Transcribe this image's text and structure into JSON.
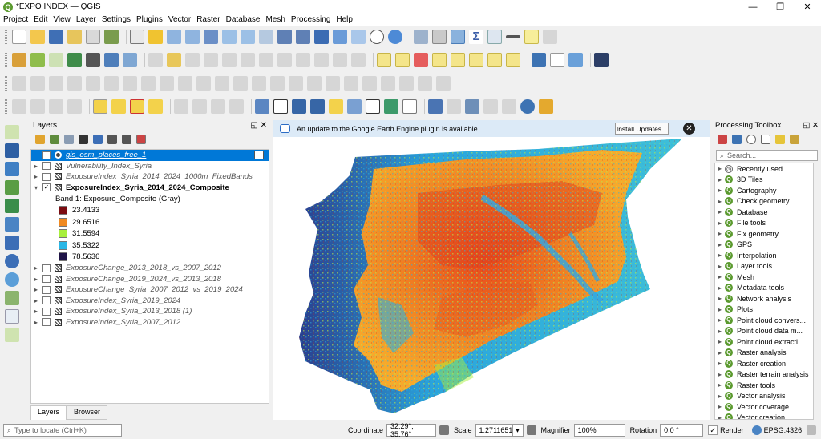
{
  "window": {
    "title": "*EXPO INDEX — QGIS",
    "logo_letter": "Q",
    "minimize": "—",
    "restore": "❐",
    "close": "✕"
  },
  "menu": [
    "Project",
    "Edit",
    "View",
    "Layer",
    "Settings",
    "Plugins",
    "Vector",
    "Raster",
    "Database",
    "Mesh",
    "Processing",
    "Help"
  ],
  "layers_panel": {
    "title": "Layers",
    "items": [
      {
        "name": "gis_osm_places_free_1",
        "checked": false,
        "selected": true,
        "expander": "",
        "style": "sel"
      },
      {
        "name": "Vulnerability_Index_Syria",
        "checked": false,
        "expander": "▸"
      },
      {
        "name": "ExposureIndex_Syria_2014_2024_1000m_FixedBands",
        "checked": false,
        "expander": "▸"
      },
      {
        "name": "ExposureIndex_Syria_2014_2024_Composite",
        "checked": true,
        "expander": "▾",
        "bold": true
      }
    ],
    "band_label": "Band 1: Exposure_Composite (Gray)",
    "legend": [
      {
        "value": "23.4133",
        "color": "#7b0c12"
      },
      {
        "value": "29.6516",
        "color": "#f08a22"
      },
      {
        "value": "31.5594",
        "color": "#a8ef3c"
      },
      {
        "value": "35.5322",
        "color": "#2ab7e6"
      },
      {
        "value": "78.5636",
        "color": "#1f1447"
      }
    ],
    "items_after": [
      {
        "name": "ExposureChange_2013_2018_vs_2007_2012",
        "checked": false,
        "expander": "▸"
      },
      {
        "name": "ExposureChange_2019_2024_vs_2013_2018",
        "checked": false,
        "expander": "▸"
      },
      {
        "name": "ExposureChange_Syria_2007_2012_vs_2019_2024",
        "checked": false,
        "expander": "▸"
      },
      {
        "name": "ExposureIndex_Syria_2019_2024",
        "checked": false,
        "expander": "▸"
      },
      {
        "name": "ExposureIndex_Syria_2013_2018 (1)",
        "checked": false,
        "expander": "▸"
      },
      {
        "name": "ExposureIndex_Syria_2007_2012",
        "checked": false,
        "expander": "▸"
      }
    ],
    "tabs": [
      "Layers",
      "Browser"
    ]
  },
  "map": {
    "banner_message": "An update to the Google Earth Engine plugin is available",
    "install_button": "Install Updates...",
    "close_glyph": "✕"
  },
  "toolbox": {
    "title": "Processing Toolbox",
    "search_placeholder": "Search...",
    "items": [
      {
        "label": "Recently used",
        "icon": "clock-icon"
      },
      {
        "label": "3D Tiles",
        "icon": "qgis-icon"
      },
      {
        "label": "Cartography",
        "icon": "qgis-icon"
      },
      {
        "label": "Check geometry",
        "icon": "qgis-icon"
      },
      {
        "label": "Database",
        "icon": "qgis-icon"
      },
      {
        "label": "File tools",
        "icon": "qgis-icon"
      },
      {
        "label": "Fix geometry",
        "icon": "qgis-icon"
      },
      {
        "label": "GPS",
        "icon": "qgis-icon"
      },
      {
        "label": "Interpolation",
        "icon": "qgis-icon"
      },
      {
        "label": "Layer tools",
        "icon": "qgis-icon"
      },
      {
        "label": "Mesh",
        "icon": "qgis-icon"
      },
      {
        "label": "Metadata tools",
        "icon": "qgis-icon"
      },
      {
        "label": "Network analysis",
        "icon": "qgis-icon"
      },
      {
        "label": "Plots",
        "icon": "qgis-icon"
      },
      {
        "label": "Point cloud convers...",
        "icon": "qgis-icon"
      },
      {
        "label": "Point cloud data m...",
        "icon": "qgis-icon"
      },
      {
        "label": "Point cloud extracti...",
        "icon": "qgis-icon"
      },
      {
        "label": "Raster analysis",
        "icon": "qgis-icon"
      },
      {
        "label": "Raster creation",
        "icon": "qgis-icon"
      },
      {
        "label": "Raster terrain analysis",
        "icon": "qgis-icon"
      },
      {
        "label": "Raster tools",
        "icon": "qgis-icon"
      },
      {
        "label": "Vector analysis",
        "icon": "qgis-icon"
      },
      {
        "label": "Vector coverage",
        "icon": "qgis-icon"
      },
      {
        "label": "Vector creation",
        "icon": "qgis-icon"
      }
    ]
  },
  "status": {
    "locator_placeholder": "Type to locate (Ctrl+K)",
    "coordinate_label": "Coordinate",
    "coordinate_value": "32.29°, 35.76°",
    "scale_label": "Scale",
    "scale_value": "1:2711651",
    "magnifier_label": "Magnifier",
    "magnifier_value": "100%",
    "rotation_label": "Rotation",
    "rotation_value": "0.0 °",
    "render_label": "Render",
    "crs": "EPSG:4326"
  }
}
